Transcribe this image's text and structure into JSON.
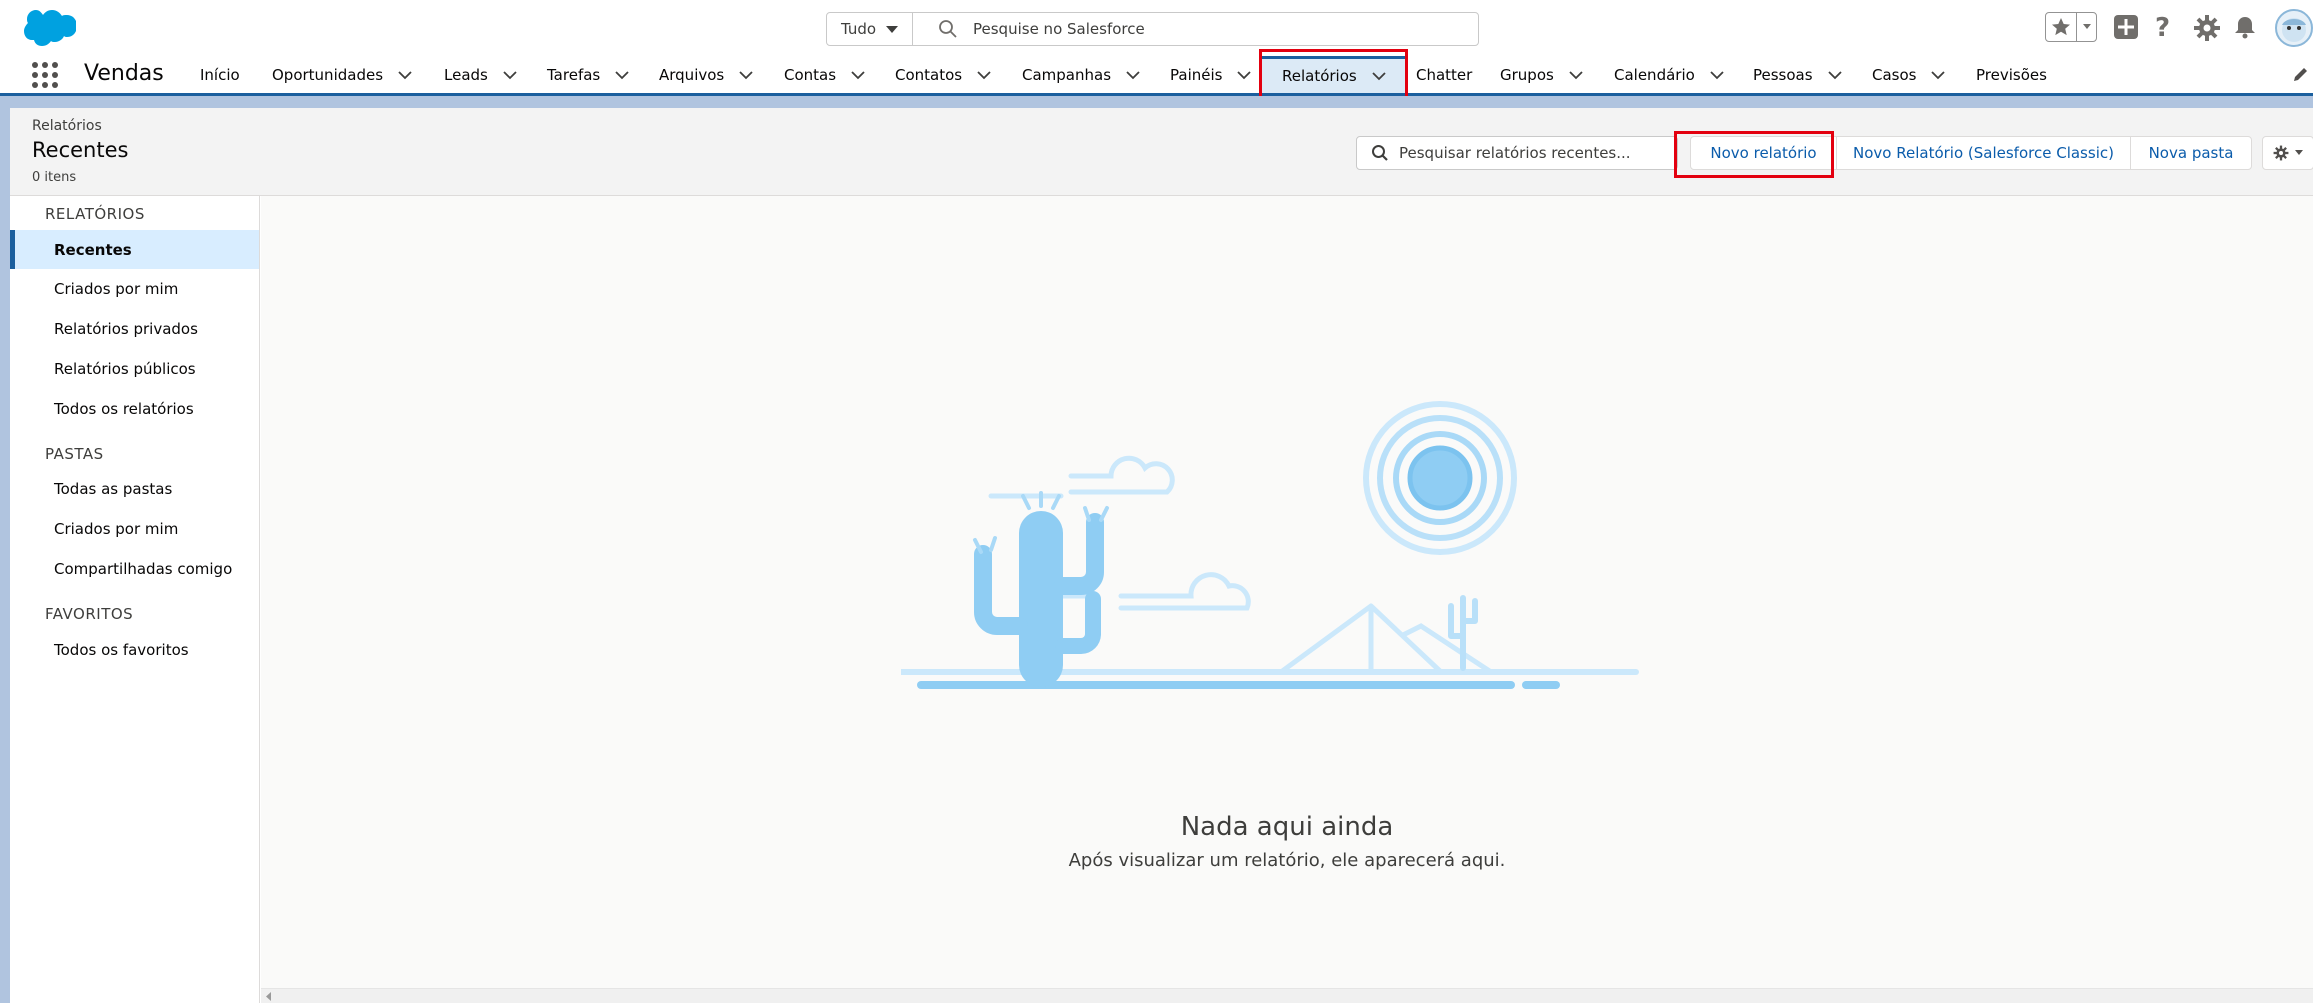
{
  "global_header": {
    "search_scope": "Tudo",
    "search_placeholder": "Pesquise no Salesforce"
  },
  "nav": {
    "app_name": "Vendas",
    "items": [
      {
        "label": "Início",
        "has_menu": false
      },
      {
        "label": "Oportunidades",
        "has_menu": true
      },
      {
        "label": "Leads",
        "has_menu": true
      },
      {
        "label": "Tarefas",
        "has_menu": true
      },
      {
        "label": "Arquivos",
        "has_menu": true
      },
      {
        "label": "Contas",
        "has_menu": true
      },
      {
        "label": "Contatos",
        "has_menu": true
      },
      {
        "label": "Campanhas",
        "has_menu": true
      },
      {
        "label": "Painéis",
        "has_menu": true
      },
      {
        "label": "Relatórios",
        "has_menu": true,
        "active": true
      },
      {
        "label": "Chatter",
        "has_menu": false
      },
      {
        "label": "Grupos",
        "has_menu": true
      },
      {
        "label": "Calendário",
        "has_menu": true
      },
      {
        "label": "Pessoas",
        "has_menu": true
      },
      {
        "label": "Casos",
        "has_menu": true
      },
      {
        "label": "Previsões",
        "has_menu": false
      }
    ]
  },
  "page_header": {
    "breadcrumb": "Relatórios",
    "title": "Recentes",
    "count": "0 itens",
    "search_placeholder": "Pesquisar relatórios recentes...",
    "btn_new_report": "Novo relatório",
    "btn_new_report_classic": "Novo Relatório (Salesforce Classic)",
    "btn_new_folder": "Nova pasta"
  },
  "sidebar": {
    "reports_heading": "RELATÓRIOS",
    "reports_items": [
      "Recentes",
      "Criados por mim",
      "Relatórios privados",
      "Relatórios públicos",
      "Todos os relatórios"
    ],
    "folders_heading": "PASTAS",
    "folders_items": [
      "Todas as pastas",
      "Criados por mim",
      "Compartilhadas comigo"
    ],
    "favorites_heading": "FAVORITOS",
    "favorites_items": [
      "Todos os favoritos"
    ]
  },
  "empty_state": {
    "title": "Nada aqui ainda",
    "subtitle": "Após visualizar um relatório, ele aparecerá aqui."
  },
  "colors": {
    "brand_blue": "#1b5f9e",
    "link_blue": "#0b5cab",
    "highlight_red": "#e3000f",
    "illustration_blue": "#8fcdf3"
  }
}
